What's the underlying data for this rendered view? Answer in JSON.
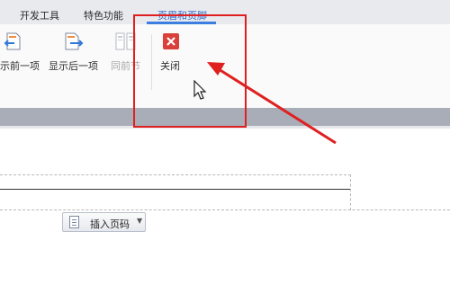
{
  "ribbon_tabs": [
    {
      "label": "开发工具",
      "active": false
    },
    {
      "label": "特色功能",
      "active": false
    },
    {
      "label": "页眉和页脚",
      "active": true
    }
  ],
  "ribbon_buttons": {
    "show_previous": {
      "label": "示前一项",
      "icon": "page-back-arrow-icon",
      "enabled": true
    },
    "show_next": {
      "label": "显示后一项",
      "icon": "page-forward-arrow-icon",
      "enabled": true
    },
    "same_as_previous": {
      "label": "同前节",
      "icon": "link-previous-section-icon",
      "enabled": false
    },
    "close": {
      "label": "关闭",
      "icon": "close-x-icon",
      "enabled": true
    }
  },
  "document": {
    "insert_page_number_label": "插入页码",
    "insert_page_number_icon": "page-document-icon"
  },
  "annotation": {
    "highlight_color": "#e02020",
    "arrow_color": "#e02020"
  },
  "colors": {
    "active_tab_text": "#2f69c6",
    "active_tab_underline": "#3b7de0",
    "close_icon_bg": "#d9403a"
  }
}
